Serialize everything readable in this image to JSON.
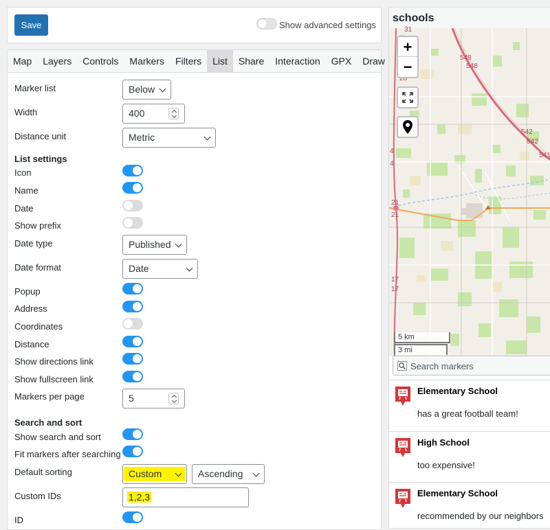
{
  "toolbar": {
    "save_label": "Save",
    "advanced_label": "Show advanced settings",
    "advanced_on": false
  },
  "tabs": [
    {
      "label": "Map"
    },
    {
      "label": "Layers"
    },
    {
      "label": "Controls"
    },
    {
      "label": "Markers"
    },
    {
      "label": "Filters"
    },
    {
      "label": "List",
      "active": true
    },
    {
      "label": "Share"
    },
    {
      "label": "Interaction"
    },
    {
      "label": "GPX"
    },
    {
      "label": "Draw"
    }
  ],
  "form": {
    "marker_list": {
      "label": "Marker list",
      "value": "Below"
    },
    "width": {
      "label": "Width",
      "value": "400"
    },
    "distance_unit": {
      "label": "Distance unit",
      "value": "Metric"
    },
    "list_settings_title": "List settings",
    "icon": {
      "label": "Icon",
      "on": true
    },
    "name": {
      "label": "Name",
      "on": true
    },
    "date": {
      "label": "Date",
      "on": false
    },
    "show_prefix": {
      "label": "Show prefix",
      "on": false
    },
    "date_type": {
      "label": "Date type",
      "value": "Published"
    },
    "date_format": {
      "label": "Date format",
      "value": "Date"
    },
    "popup": {
      "label": "Popup",
      "on": true
    },
    "address": {
      "label": "Address",
      "on": true
    },
    "coordinates": {
      "label": "Coordinates",
      "on": false
    },
    "distance": {
      "label": "Distance",
      "on": true
    },
    "show_directions_link": {
      "label": "Show directions link",
      "on": true
    },
    "show_fullscreen_link": {
      "label": "Show fullscreen link",
      "on": true
    },
    "markers_per_page": {
      "label": "Markers per page",
      "value": "5"
    },
    "search_sort_title": "Search and sort",
    "show_search_sort": {
      "label": "Show search and sort",
      "on": true
    },
    "fit_markers": {
      "label": "Fit markers after searching",
      "on": true
    },
    "default_sorting": {
      "label": "Default sorting",
      "value": "Custom",
      "order": "Ascending"
    },
    "custom_ids": {
      "label": "Custom IDs",
      "value": "1,2,3"
    },
    "id": {
      "label": "ID",
      "on": true
    }
  },
  "map": {
    "title": "schools",
    "zoom_in": "+",
    "zoom_out": "−",
    "scale_km": "5 km",
    "scale_mi": "3 mi",
    "road_labels": [
      "31",
      "548",
      "548",
      "28",
      "542",
      "542",
      "541",
      "4",
      "4",
      "21",
      "21",
      "17",
      "17"
    ]
  },
  "search": {
    "placeholder": "Search markers"
  },
  "markers": [
    {
      "title": "Elementary School",
      "description": "has a great football team!"
    },
    {
      "title": "High School",
      "description": "too expensive!"
    },
    {
      "title": "Elementary School",
      "description": "recommended by our neighbors"
    }
  ],
  "colors": {
    "accent": "#2271b1",
    "toggle_on": "#2196f3",
    "highlight": "#fff200",
    "marker_red": "#d63638"
  }
}
